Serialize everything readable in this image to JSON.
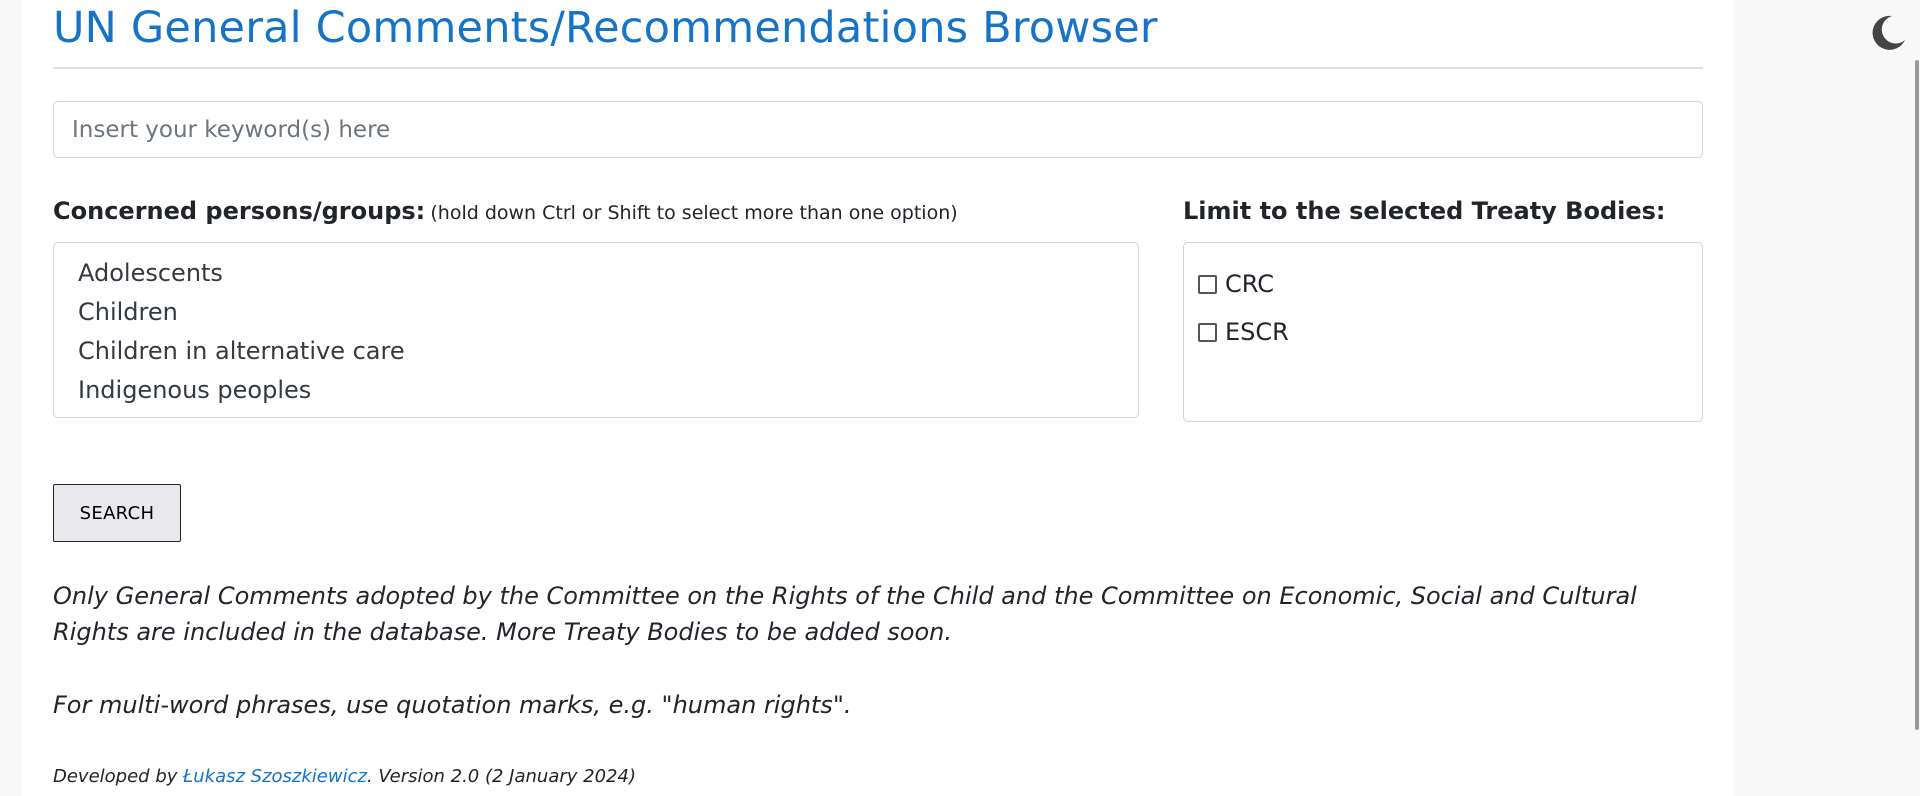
{
  "header": {
    "title": "UN General Comments/Recommendations Browser"
  },
  "search": {
    "placeholder": "Insert your keyword(s) here",
    "value": ""
  },
  "groups": {
    "label": "Concerned persons/groups:",
    "hint": "(hold down Ctrl or Shift to select more than one option)",
    "options": [
      "Adolescents",
      "Children",
      "Children in alternative care",
      "Indigenous peoples"
    ]
  },
  "treaty_bodies": {
    "label": "Limit to the selected Treaty Bodies:",
    "items": [
      {
        "label": "CRC",
        "checked": false
      },
      {
        "label": "ESCR",
        "checked": false
      }
    ]
  },
  "search_button": {
    "label": "SEARCH"
  },
  "notes": {
    "note1": "Only General Comments adopted by the Committee on the Rights of the Child and the Committee on Economic, Social and Cultural Rights are included in the database. More Treaty Bodies to be added soon.",
    "note2": "For multi-word phrases, use quotation marks, e.g. \"human rights\"."
  },
  "footer": {
    "prefix": "Developed by ",
    "author": "Łukasz Szoszkiewicz",
    "suffix": ". Version 2.0 (2 January 2024)"
  },
  "icons": {
    "theme_toggle": "moon-icon"
  },
  "colors": {
    "accent": "#1674c8",
    "border": "#ced4da"
  }
}
